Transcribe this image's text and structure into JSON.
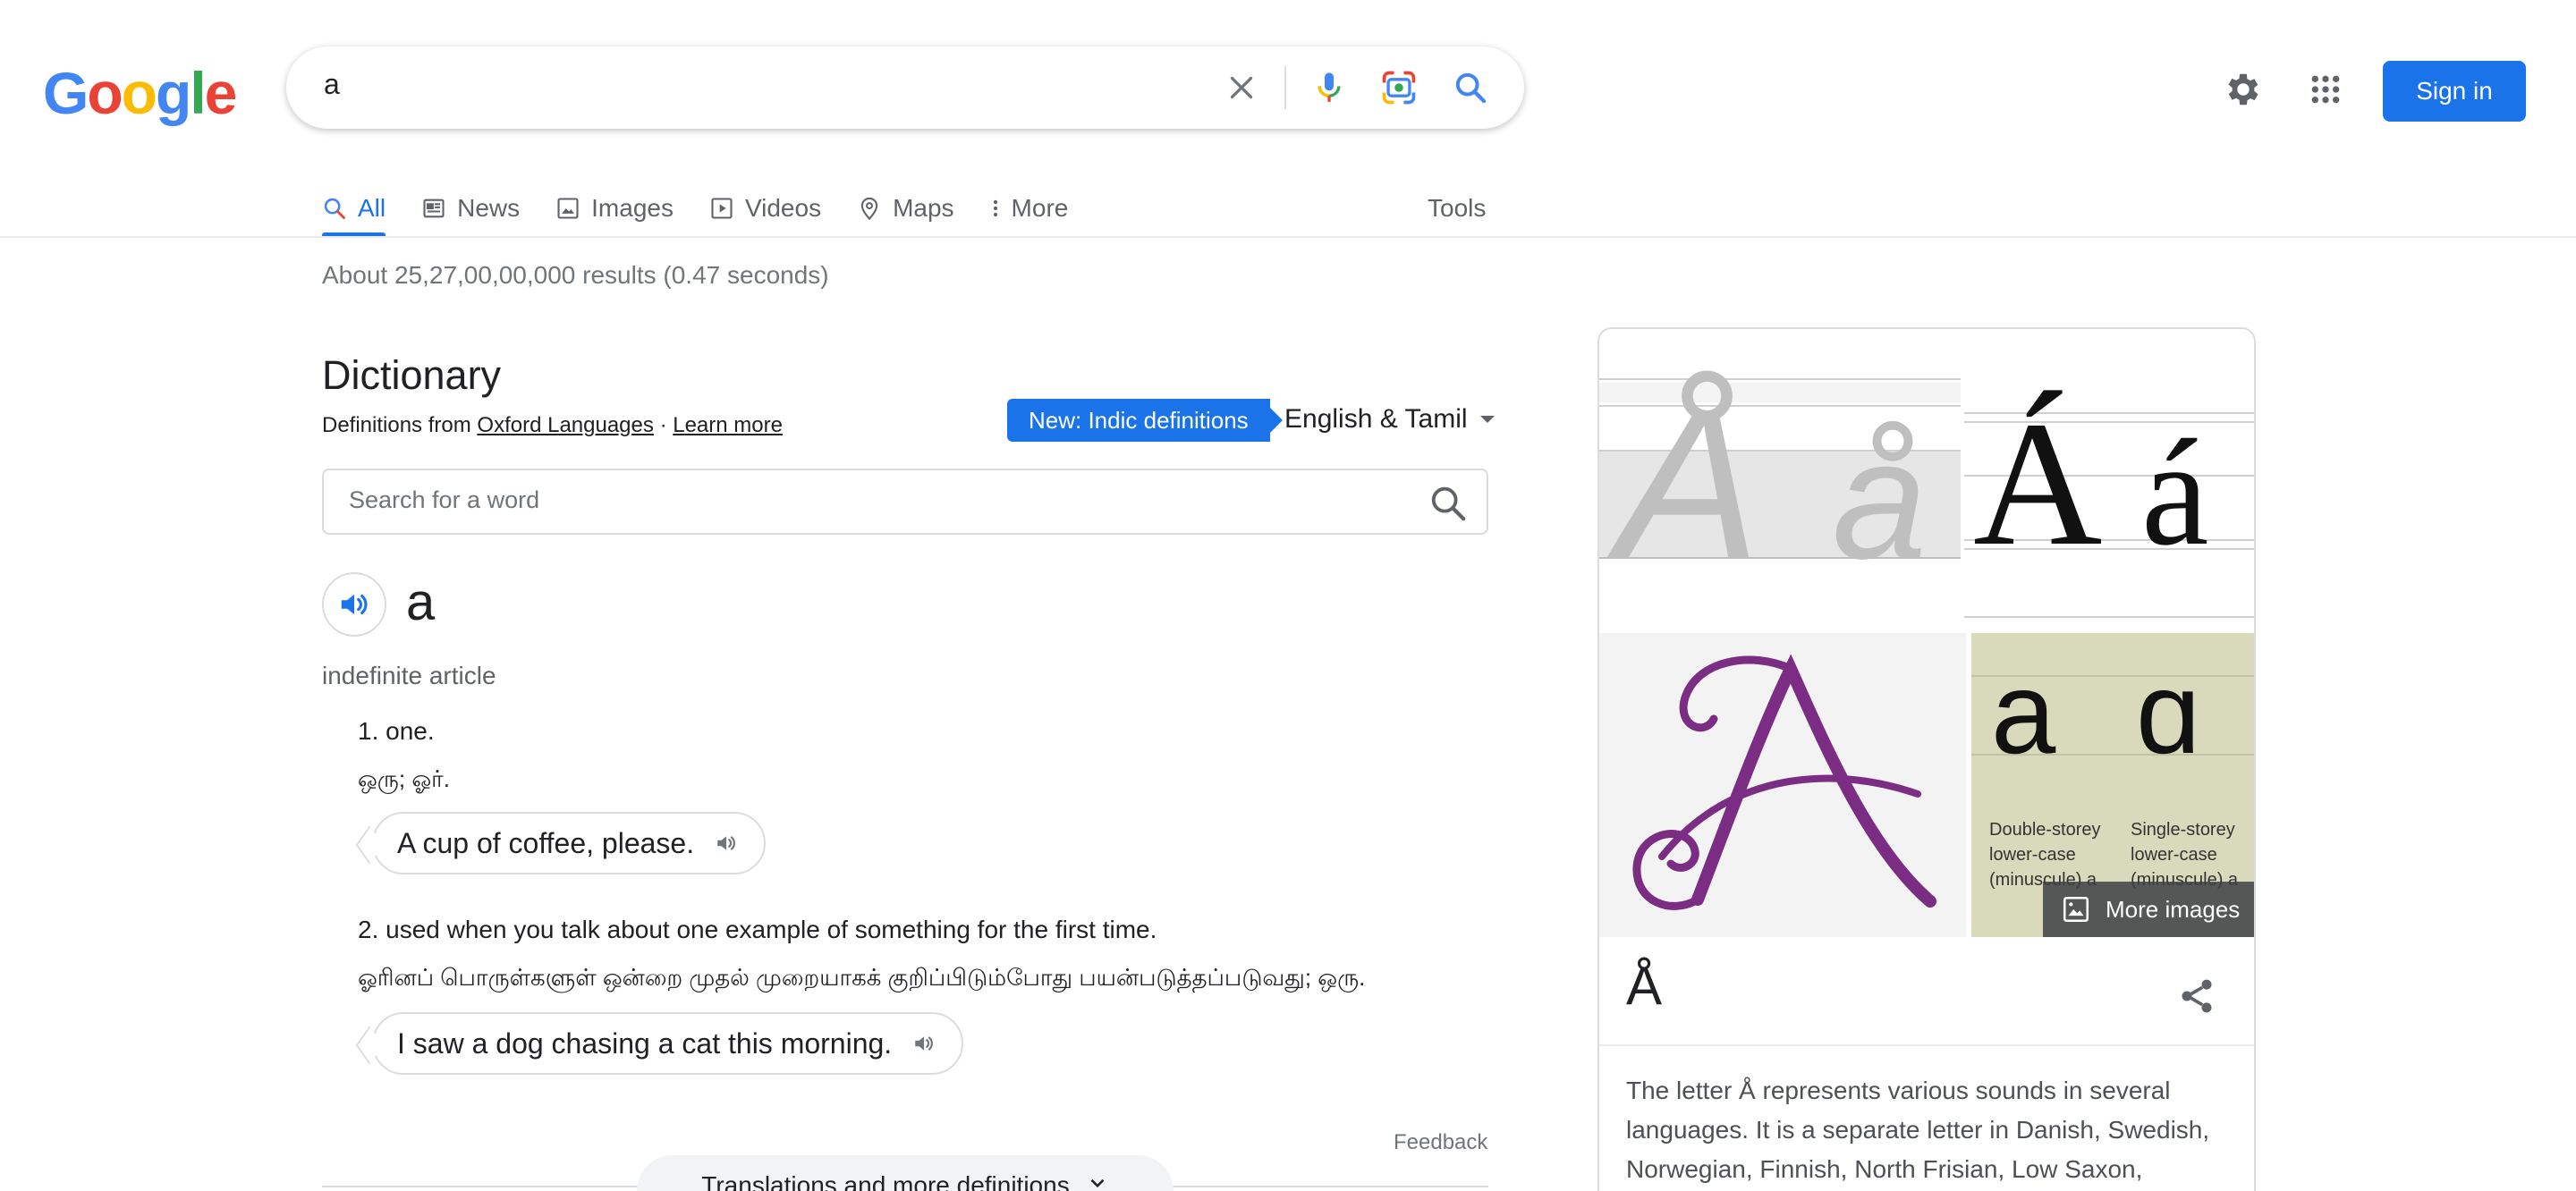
{
  "logo": {
    "letters": [
      "G",
      "o",
      "o",
      "g",
      "l",
      "e"
    ],
    "colors": [
      "#4285f4",
      "#ea4335",
      "#fbbc05",
      "#4285f4",
      "#34a853",
      "#ea4335"
    ]
  },
  "search": {
    "query": "a",
    "icons": [
      "close-icon",
      "mic-icon",
      "camera-lens-icon",
      "search-icon"
    ]
  },
  "header": {
    "settings_icon": "gear-icon",
    "apps_icon": "grid-icon",
    "signin_label": "Sign in",
    "accent": "#1a73e8"
  },
  "tabs": [
    {
      "label": "All",
      "icon": "search-icon",
      "active": true
    },
    {
      "label": "News",
      "icon": "news-icon",
      "active": false
    },
    {
      "label": "Images",
      "icon": "image-icon",
      "active": false
    },
    {
      "label": "Videos",
      "icon": "play-icon",
      "active": false
    },
    {
      "label": "Maps",
      "icon": "pin-icon",
      "active": false
    },
    {
      "label": "More",
      "icon": "more-vert-icon",
      "active": false
    }
  ],
  "tools_label": "Tools",
  "stats": "About 25,27,00,00,000 results (0.47 seconds)",
  "dictionary": {
    "title": "Dictionary",
    "sub_prefix": "Definitions from",
    "source_link": "Oxford Languages",
    "separator": "·",
    "learn_more": "Learn more",
    "badge": "New: Indic definitions",
    "language": "English & Tamil",
    "search_placeholder": "Search for a word",
    "headword": "a",
    "part_of_speech": "indefinite article",
    "senses": [
      {
        "number": "1.",
        "definition": "one.",
        "tamil": "ஒரு; ஓர்.",
        "example": "A cup of coffee, please."
      },
      {
        "number": "2.",
        "definition": "used when you talk about one example of something for the first time.",
        "tamil": "ஓரினப் பொருள்களுள் ஒன்றை முதல் முறையாகக் குறிப்பிடும்போது பயன்படுத்தப்படுவது; ஒரு.",
        "example": "I saw a dog chasing a cat this morning."
      }
    ],
    "feedback": "Feedback",
    "more_definitions": "Translations and more definitions"
  },
  "knowledge_panel": {
    "images": {
      "img1_glyphs": [
        "Å",
        "å"
      ],
      "img2_glyphs": [
        "Á",
        "á"
      ],
      "img3_glyph": "A",
      "img4_glyphs": [
        "a",
        "ɑ"
      ],
      "img4_captions": [
        [
          "Double-storey",
          "lower-case",
          "(minuscule) a"
        ],
        [
          "Single-storey",
          "lower-case",
          "(minuscule) a"
        ]
      ],
      "purple": "#7b2d83"
    },
    "more_images": "More images",
    "title": "Å",
    "share_icon": "share-icon",
    "description": "The letter Å represents various sounds in several languages. It is a separate letter in Danish, Swedish, Norwegian, Finnish, North Frisian, Low Saxon,"
  }
}
